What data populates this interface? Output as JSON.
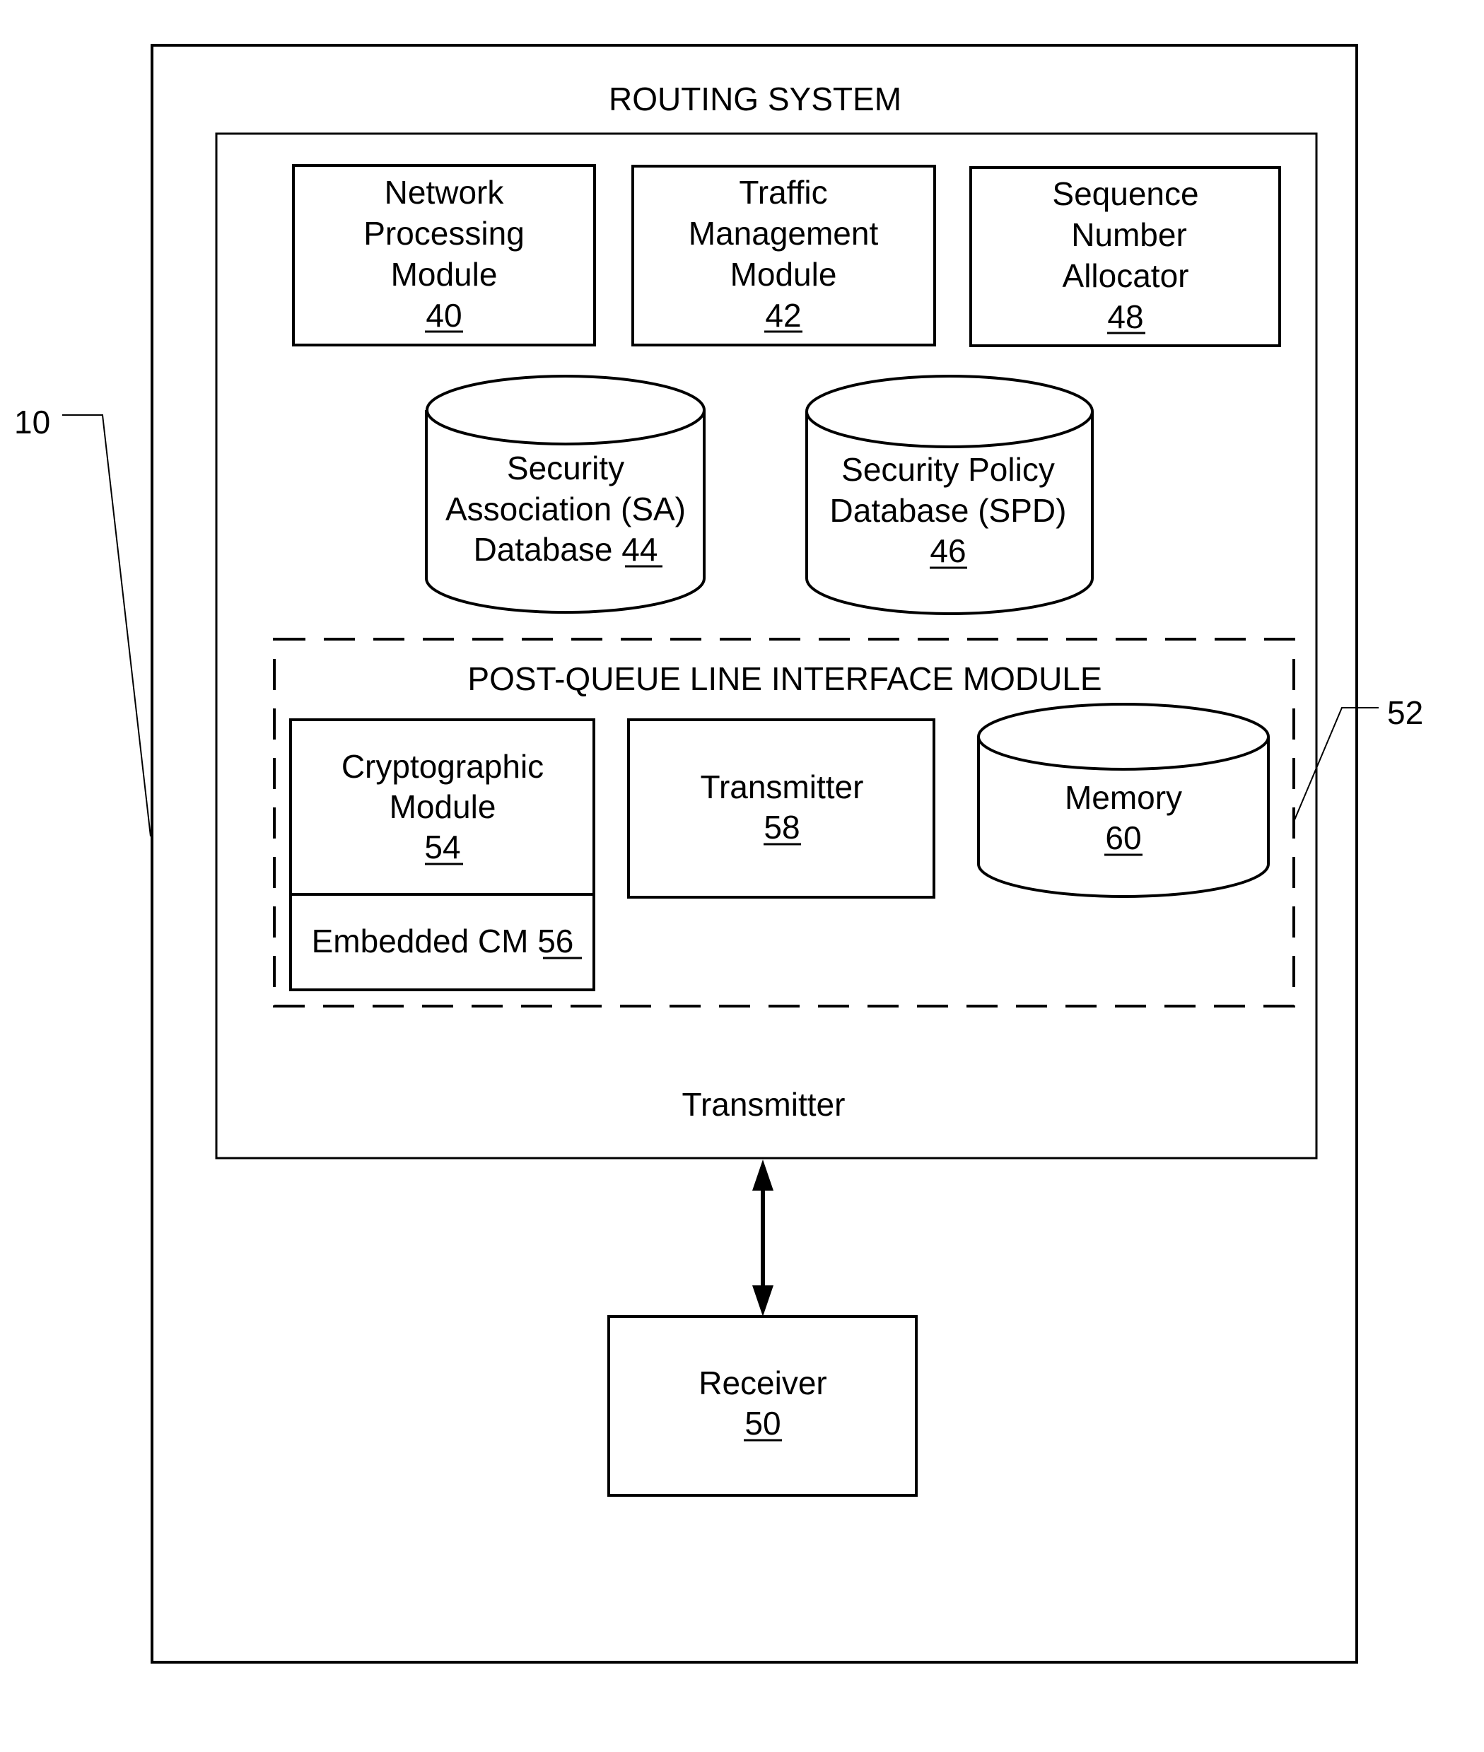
{
  "figure": {
    "system_title": "ROUTING SYSTEM",
    "ref_system": "10",
    "modules": [
      {
        "lines": [
          "Network",
          "Processing",
          "Module"
        ],
        "ref": "40"
      },
      {
        "lines": [
          "Traffic",
          "Management",
          "Module"
        ],
        "ref": "42"
      },
      {
        "lines": [
          "Sequence",
          "Number",
          "Allocator"
        ],
        "ref": "48"
      }
    ],
    "databases": [
      {
        "lines": [
          "Security",
          "Association (SA)",
          "Database "
        ],
        "ref": "44"
      },
      {
        "lines": [
          "Security Policy",
          "Database (SPD)"
        ],
        "ref": "46"
      }
    ],
    "line_interface": {
      "title": "POST-QUEUE LINE INTERFACE MODULE",
      "ref": "52",
      "crypto": {
        "lines": [
          "Cryptographic",
          "Module"
        ],
        "ref": "54"
      },
      "embedded": {
        "label": "Embedded CM ",
        "ref": "56"
      },
      "transmitter": {
        "label": "Transmitter",
        "ref": "58"
      },
      "memory": {
        "label": "Memory",
        "ref": "60"
      }
    },
    "transmitter_label": "Transmitter",
    "receiver": {
      "label": "Receiver",
      "ref": "50"
    }
  }
}
